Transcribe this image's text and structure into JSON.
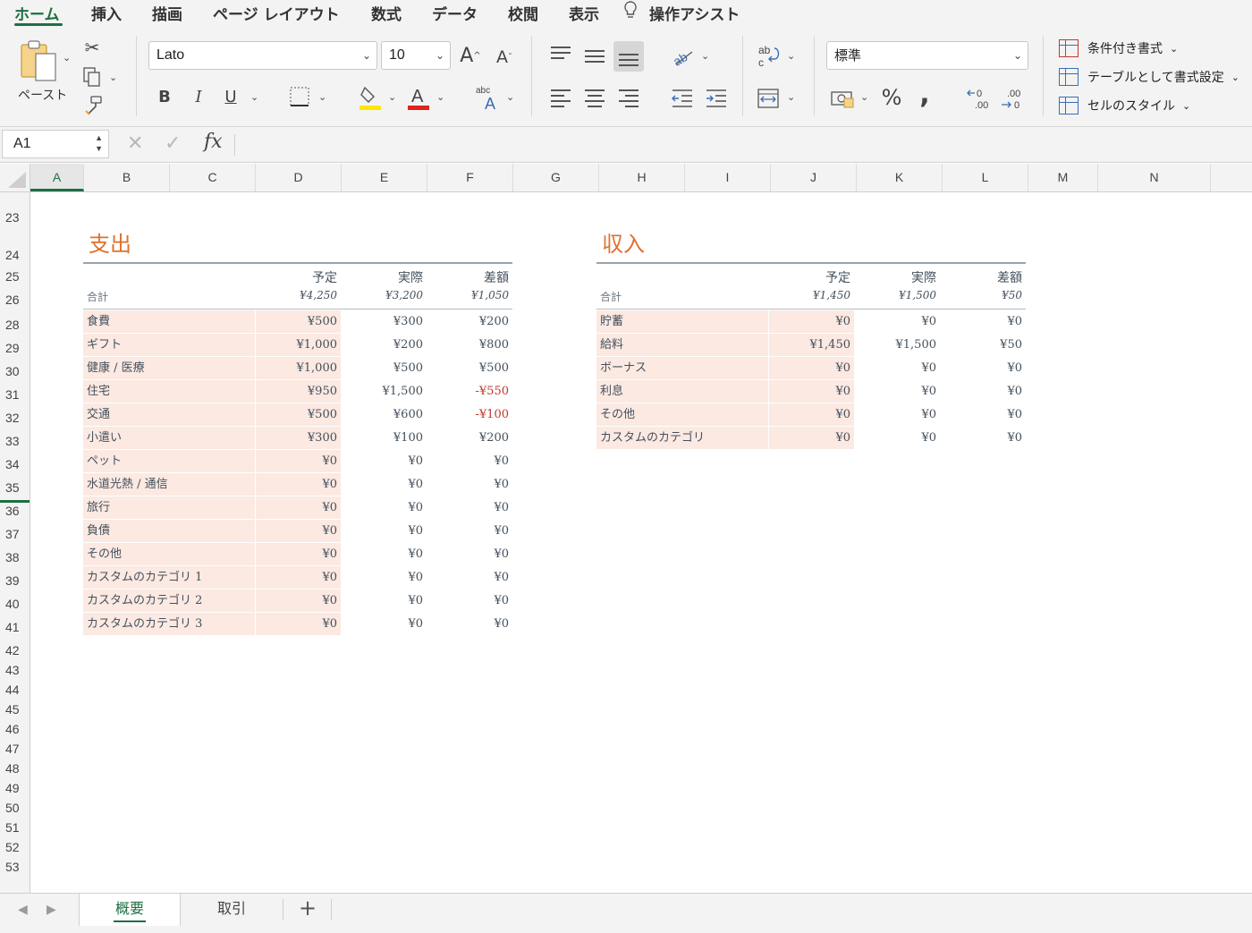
{
  "ribbon_tabs": [
    {
      "label": "ホーム",
      "active": true
    },
    {
      "label": "挿入"
    },
    {
      "label": "描画"
    },
    {
      "label": "ページ レイアウト"
    },
    {
      "label": "数式"
    },
    {
      "label": "データ"
    },
    {
      "label": "校閲"
    },
    {
      "label": "表示"
    },
    {
      "label": "操作アシスト"
    }
  ],
  "ribbon": {
    "paste_label": "ペースト",
    "font_name": "Lato",
    "font_size": "10",
    "bold": "B",
    "italic": "I",
    "underline": "U",
    "number_format": "標準",
    "percent": "%",
    "comma": ",",
    "conditional_format": "条件付き書式",
    "format_as_table": "テーブルとして書式設定",
    "cell_styles": "セルのスタイル",
    "highlight_color": "#ffe600",
    "font_color": "#e2231a"
  },
  "formula_bar": {
    "name_box": "A1",
    "cancel": "✕",
    "enter": "✓",
    "fx": "fx",
    "formula": ""
  },
  "columns": [
    "A",
    "B",
    "C",
    "D",
    "E",
    "F",
    "G",
    "H",
    "I",
    "J",
    "K",
    "L",
    "M",
    "N"
  ],
  "selected_column": "A",
  "rows": [
    "23",
    "24",
    "25",
    "26",
    "28",
    "29",
    "30",
    "31",
    "32",
    "33",
    "34",
    "35",
    "36",
    "37",
    "38",
    "39",
    "40",
    "41",
    "42",
    "43",
    "44",
    "45",
    "46",
    "47",
    "48",
    "49",
    "50",
    "51",
    "52",
    "53"
  ],
  "expenses": {
    "title": "支出",
    "headers": {
      "plan": "予定",
      "actual": "実際",
      "diff": "差額"
    },
    "total_label": "合計",
    "totals": {
      "plan": "¥4,250",
      "actual": "¥3,200",
      "diff": "¥1,050"
    },
    "items": [
      {
        "category": "食費",
        "plan": "¥500",
        "actual": "¥300",
        "diff": "¥200"
      },
      {
        "category": "ギフト",
        "plan": "¥1,000",
        "actual": "¥200",
        "diff": "¥800"
      },
      {
        "category": "健康 / 医療",
        "plan": "¥1,000",
        "actual": "¥500",
        "diff": "¥500"
      },
      {
        "category": "住宅",
        "plan": "¥950",
        "actual": "¥1,500",
        "diff": "-¥550",
        "negative": true
      },
      {
        "category": "交通",
        "plan": "¥500",
        "actual": "¥600",
        "diff": "-¥100",
        "negative": true
      },
      {
        "category": "小遣い",
        "plan": "¥300",
        "actual": "¥100",
        "diff": "¥200"
      },
      {
        "category": "ペット",
        "plan": "¥0",
        "actual": "¥0",
        "diff": "¥0"
      },
      {
        "category": "水道光熱 / 通信",
        "plan": "¥0",
        "actual": "¥0",
        "diff": "¥0"
      },
      {
        "category": "旅行",
        "plan": "¥0",
        "actual": "¥0",
        "diff": "¥0"
      },
      {
        "category": "負債",
        "plan": "¥0",
        "actual": "¥0",
        "diff": "¥0"
      },
      {
        "category": "その他",
        "plan": "¥0",
        "actual": "¥0",
        "diff": "¥0"
      },
      {
        "category": "カスタムのカテゴリ 1",
        "plan": "¥0",
        "actual": "¥0",
        "diff": "¥0"
      },
      {
        "category": "カスタムのカテゴリ 2",
        "plan": "¥0",
        "actual": "¥0",
        "diff": "¥0"
      },
      {
        "category": "カスタムのカテゴリ 3",
        "plan": "¥0",
        "actual": "¥0",
        "diff": "¥0"
      }
    ]
  },
  "income": {
    "title": "収入",
    "headers": {
      "plan": "予定",
      "actual": "実際",
      "diff": "差額"
    },
    "total_label": "合計",
    "totals": {
      "plan": "¥1,450",
      "actual": "¥1,500",
      "diff": "¥50"
    },
    "items": [
      {
        "category": "貯蓄",
        "plan": "¥0",
        "actual": "¥0",
        "diff": "¥0"
      },
      {
        "category": "給料",
        "plan": "¥1,450",
        "actual": "¥1,500",
        "diff": "¥50"
      },
      {
        "category": "ボーナス",
        "plan": "¥0",
        "actual": "¥0",
        "diff": "¥0"
      },
      {
        "category": "利息",
        "plan": "¥0",
        "actual": "¥0",
        "diff": "¥0"
      },
      {
        "category": "その他",
        "plan": "¥0",
        "actual": "¥0",
        "diff": "¥0"
      },
      {
        "category": "カスタムのカテゴリ",
        "plan": "¥0",
        "actual": "¥0",
        "diff": "¥0"
      }
    ]
  },
  "sheet_tabs": [
    {
      "label": "概要",
      "active": true
    },
    {
      "label": "取引"
    }
  ],
  "add_sheet": "+"
}
